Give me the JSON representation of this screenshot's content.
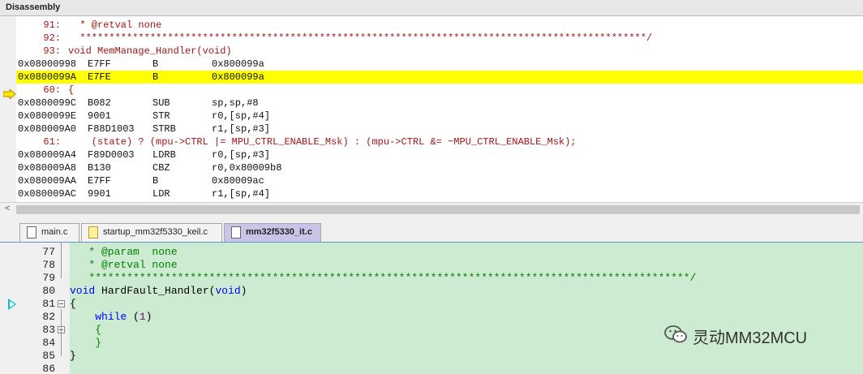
{
  "disassembly": {
    "title": "Disassembly",
    "rows": [
      {
        "kind": "src",
        "num": "91:",
        "text": "  * @retval none"
      },
      {
        "kind": "src",
        "num": "92:",
        "text": "  *************************************************************************************************/"
      },
      {
        "kind": "src",
        "num": "93:",
        "text": "void MemManage_Handler(void)"
      },
      {
        "kind": "asm",
        "addr": "0x08000998",
        "op": "E7FF",
        "mn": "B",
        "arg": "0x800099a"
      },
      {
        "kind": "asm",
        "addr": "0x0800099A",
        "op": "E7FE",
        "mn": "B",
        "arg": "0x800099a",
        "current": true
      },
      {
        "kind": "src",
        "num": "60:",
        "text": "{"
      },
      {
        "kind": "asm",
        "addr": "0x0800099C",
        "op": "B082",
        "mn": "SUB",
        "arg": "sp,sp,#8"
      },
      {
        "kind": "asm",
        "addr": "0x0800099E",
        "op": "9001",
        "mn": "STR",
        "arg": "r0,[sp,#4]"
      },
      {
        "kind": "asm",
        "addr": "0x080009A0",
        "op": "F88D1003",
        "mn": "STRB",
        "arg": "r1,[sp,#3]"
      },
      {
        "kind": "src",
        "num": "61:",
        "text": "    (state) ? (mpu->CTRL |= MPU_CTRL_ENABLE_Msk) : (mpu->CTRL &= ~MPU_CTRL_ENABLE_Msk);"
      },
      {
        "kind": "asm",
        "addr": "0x080009A4",
        "op": "F89D0003",
        "mn": "LDRB",
        "arg": "r0,[sp,#3]"
      },
      {
        "kind": "asm",
        "addr": "0x080009A8",
        "op": "B130",
        "mn": "CBZ",
        "arg": "r0,0x80009b8"
      },
      {
        "kind": "asm",
        "addr": "0x080009AA",
        "op": "E7FF",
        "mn": "B",
        "arg": "0x80009ac"
      },
      {
        "kind": "asm",
        "addr": "0x080009AC",
        "op": "9901",
        "mn": "LDR",
        "arg": "r1,[sp,#4]"
      }
    ],
    "scroll_left": "<"
  },
  "tabs": [
    {
      "label": "main.c",
      "style": "plain",
      "active": false
    },
    {
      "label": "startup_mm32f5330_keil.c",
      "style": "yellow",
      "active": false
    },
    {
      "label": "mm32f5330_it.c",
      "style": "plain",
      "active": true
    }
  ],
  "editor": {
    "lines": [
      {
        "num": "77",
        "parts": [
          {
            "t": "   * @param  none",
            "c": "cmt"
          }
        ]
      },
      {
        "num": "78",
        "parts": [
          {
            "t": "   * @retval none",
            "c": "cmt"
          }
        ]
      },
      {
        "num": "79",
        "parts": [
          {
            "t": "   ***********************************************************************************************/",
            "c": "cmt"
          }
        ]
      },
      {
        "num": "80",
        "parts": [
          {
            "t": "void",
            "c": "kw"
          },
          {
            "t": " HardFault_Handler(",
            "c": "fn"
          },
          {
            "t": "void",
            "c": "kw"
          },
          {
            "t": ")",
            "c": "fn"
          }
        ]
      },
      {
        "num": "81",
        "parts": [
          {
            "t": "{",
            "c": "fn"
          }
        ]
      },
      {
        "num": "82",
        "parts": [
          {
            "t": "    ",
            "c": "fn"
          },
          {
            "t": "while",
            "c": "kw"
          },
          {
            "t": " (",
            "c": "fn"
          },
          {
            "t": "1",
            "c": "num"
          },
          {
            "t": ")",
            "c": "fn"
          }
        ]
      },
      {
        "num": "83",
        "parts": [
          {
            "t": "    {",
            "c": "cmt"
          }
        ]
      },
      {
        "num": "84",
        "parts": [
          {
            "t": "    }",
            "c": "cmt"
          }
        ]
      },
      {
        "num": "85",
        "parts": [
          {
            "t": "}",
            "c": "fn"
          }
        ]
      },
      {
        "num": "86",
        "parts": []
      }
    ]
  },
  "watermark": {
    "text": "灵动MM32MCU"
  },
  "colors": {
    "highlight": "#ffff00",
    "editor_bg": "#cdebd0",
    "source_line": "#a31515",
    "comment": "#008000",
    "keyword": "#0000ff"
  }
}
